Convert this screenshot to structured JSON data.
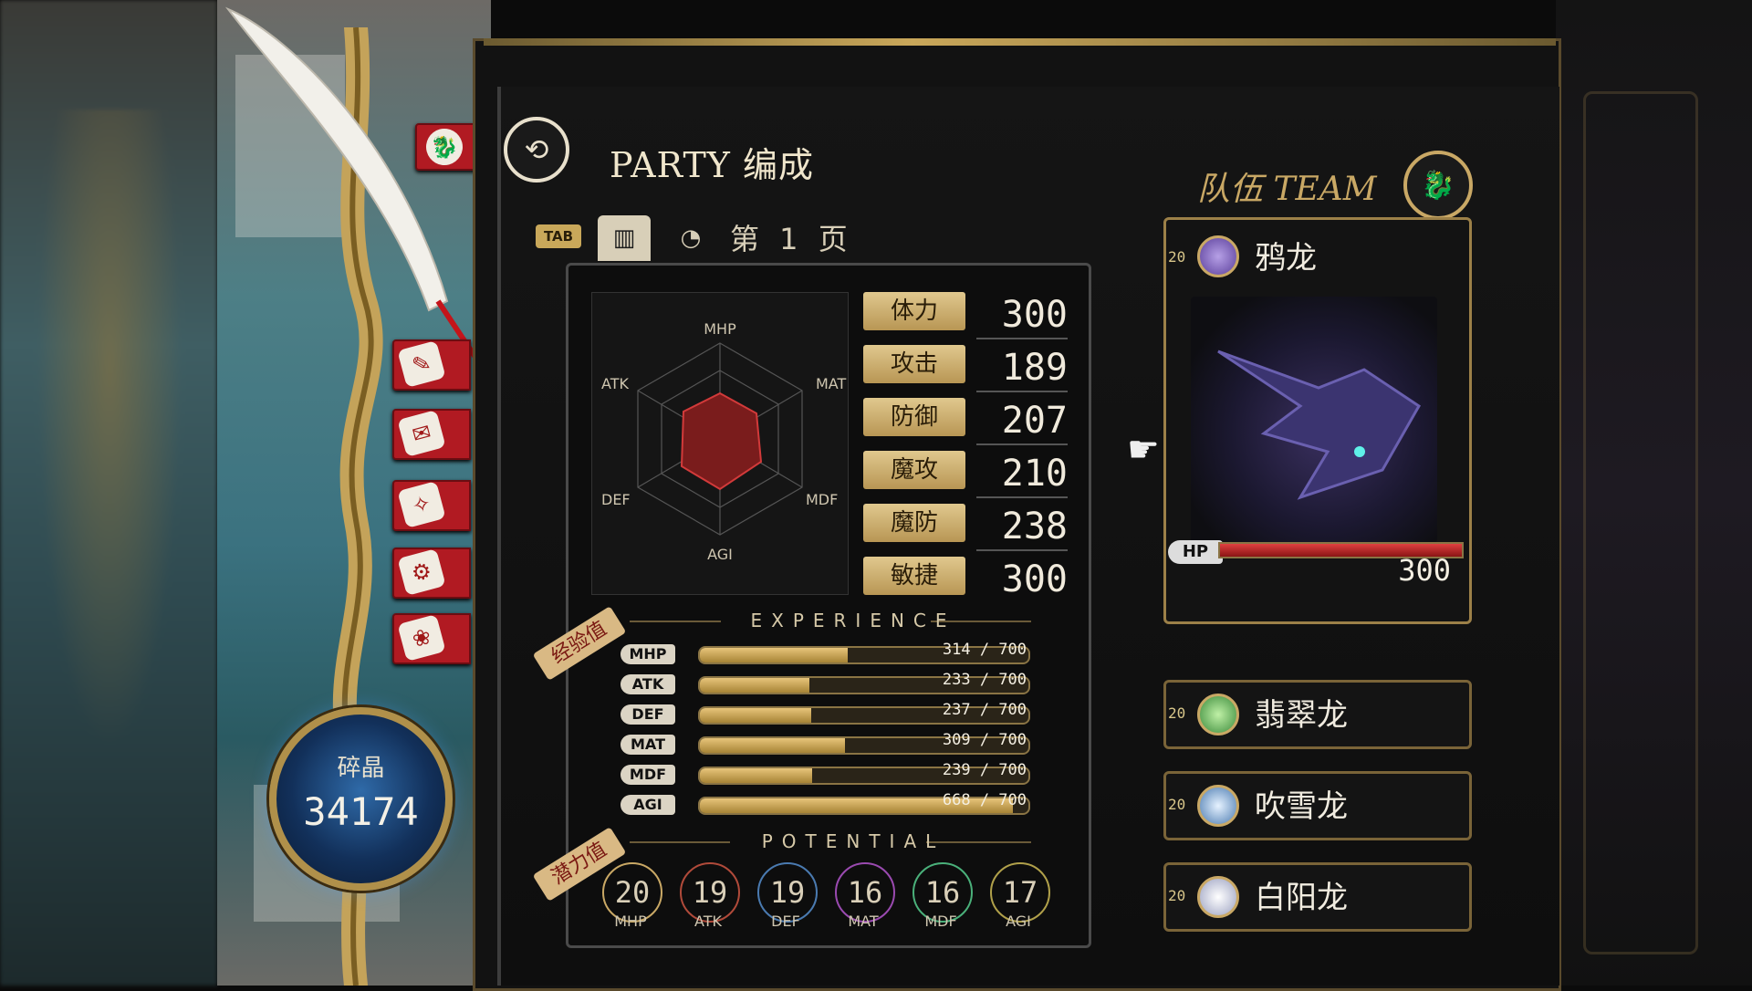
{
  "crystal": {
    "label": "碎晶",
    "value": "34174"
  },
  "menu_icons": [
    "party-icon",
    "quill-icon",
    "map-icon",
    "scroll-icon",
    "settings-icon",
    "bag-icon"
  ],
  "header": {
    "title": "PARTY 编成",
    "tab_key": "TAB",
    "page": "第 1 页"
  },
  "radar": {
    "labels": [
      "MHP",
      "MAT",
      "MDF",
      "AGI",
      "DEF",
      "ATK"
    ]
  },
  "stats": [
    {
      "label": "体力",
      "value": "300"
    },
    {
      "label": "攻击",
      "value": "189"
    },
    {
      "label": "防御",
      "value": "207"
    },
    {
      "label": "魔攻",
      "value": "210"
    },
    {
      "label": "魔防",
      "value": "238"
    },
    {
      "label": "敏捷",
      "value": "300"
    }
  ],
  "experience": {
    "title": "EXPERIENCE",
    "tag": "经验值",
    "rows": [
      {
        "key": "MHP",
        "text": "314 / 700",
        "fraction": 0.449
      },
      {
        "key": "ATK",
        "text": "233 / 700",
        "fraction": 0.333
      },
      {
        "key": "DEF",
        "text": "237 / 700",
        "fraction": 0.339
      },
      {
        "key": "MAT",
        "text": "309 / 700",
        "fraction": 0.441
      },
      {
        "key": "MDF",
        "text": "239 / 700",
        "fraction": 0.341
      },
      {
        "key": "AGI",
        "text": "668 / 700",
        "fraction": 0.954
      }
    ]
  },
  "potential": {
    "title": "POTENTIAL",
    "tag": "潜力值",
    "items": [
      {
        "value": "20",
        "label": "MHP",
        "color": "#c9a865"
      },
      {
        "value": "19",
        "label": "ATK",
        "color": "#b04a3a"
      },
      {
        "value": "19",
        "label": "DEF",
        "color": "#4a7ab0"
      },
      {
        "value": "16",
        "label": "MAT",
        "color": "#9a4ab0"
      },
      {
        "value": "16",
        "label": "MDF",
        "color": "#4ab07a"
      },
      {
        "value": "17",
        "label": "AGI",
        "color": "#b0a04a"
      }
    ]
  },
  "team": {
    "title": "队伍 TEAM",
    "main": {
      "level": "20",
      "name": "鸦龙",
      "hp_label": "HP",
      "hp": "300",
      "hp_fraction": 1.0
    },
    "members": [
      {
        "level": "20",
        "name": "翡翠龙"
      },
      {
        "level": "20",
        "name": "吹雪龙"
      },
      {
        "level": "20",
        "name": "白阳龙"
      }
    ]
  }
}
